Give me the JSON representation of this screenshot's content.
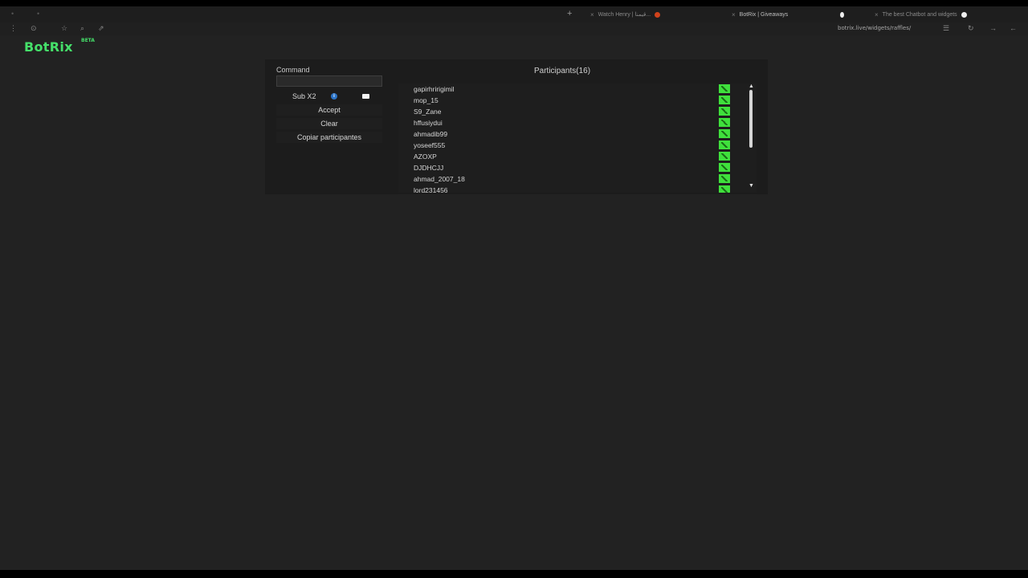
{
  "browser": {
    "tabs": [
      {
        "title": "Watch Henry | قيمنا...",
        "favicon_color": "#d0421b",
        "active": false
      },
      {
        "title": "BotRix | Giveaways",
        "favicon_color": "#eeeeee",
        "active": true
      },
      {
        "title": "The best Chatbot and widgets",
        "favicon_color": "#eeeeee",
        "active": false
      }
    ],
    "new_tab_icon": "plus-icon",
    "address": "botrix.live/widgets/raffles/"
  },
  "app": {
    "logo": "BotRix",
    "logo_badge": "BETA",
    "brand_color": "#45e06a"
  },
  "controls": {
    "command_label": "Command",
    "command_value": "",
    "command_placeholder": "",
    "sub_label": "Sub X2",
    "sub_checked": true,
    "accept_label": "Accept",
    "clear_label": "Clear",
    "copy_label": "Copiar participantes"
  },
  "participants": {
    "title": "Participants(16)",
    "kick_color": "#3fe03c",
    "items": [
      "gapirhririgimil",
      "mop_15",
      "S9_Zane",
      "hffusiydui",
      "ahmadib99",
      "yoseef555",
      "AZOXP",
      "DJDHCJJ",
      "ahmad_2007_18",
      "lord231456"
    ]
  }
}
